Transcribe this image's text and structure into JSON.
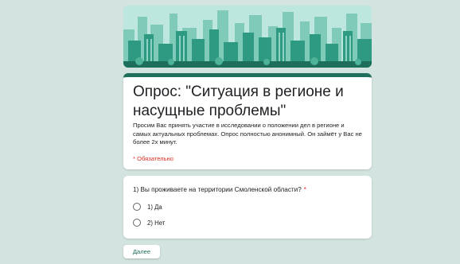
{
  "form": {
    "title": "Опрос: \"Ситуация в регионе и насущные проблемы\"",
    "description": "Просим Вас принять участие в исследовании о положении дел в регионе и самых актуальных проблемах. Опрос полностью анонимный. Он займёт у Вас не более 2х минут.",
    "required_note": "* Обязательно",
    "accent_color": "#1e6f5c"
  },
  "question": {
    "text": "1) Вы проживаете на территории Смоленской области?",
    "required_mark": "*",
    "options": [
      "1) Да",
      "2) Нет"
    ]
  },
  "navigation": {
    "next_label": "Далее"
  }
}
